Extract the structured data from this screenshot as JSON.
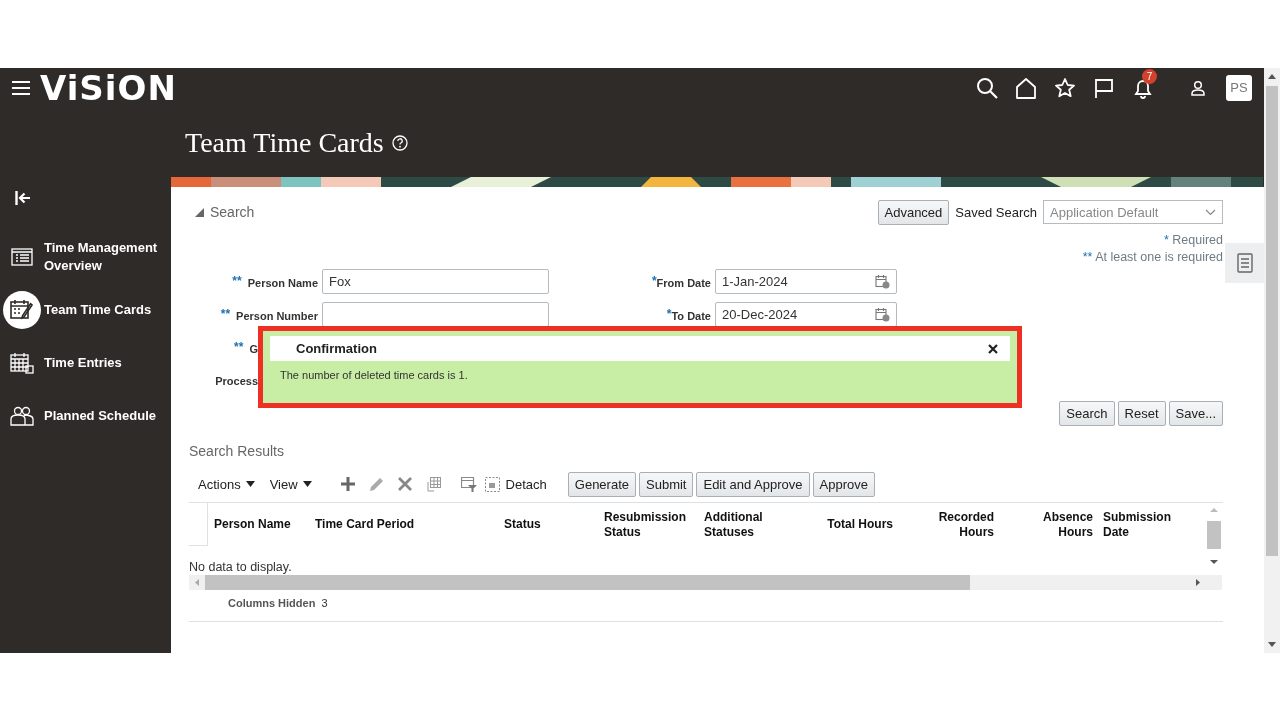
{
  "header": {
    "logo": "ViSiON",
    "notifications": "7",
    "avatar": "PS"
  },
  "sidebar": {
    "items": [
      {
        "label": "Time Management Overview",
        "selected": false
      },
      {
        "label": "Team Time Cards",
        "selected": true
      },
      {
        "label": "Time Entries",
        "selected": false
      },
      {
        "label": "Planned Schedule",
        "selected": false
      }
    ]
  },
  "page": {
    "title": "Team Time Cards"
  },
  "search": {
    "label": "Search",
    "expanded": true,
    "advanced": "Advanced",
    "saved_search_label": "Saved Search",
    "saved_search": "Application Default",
    "notes": [
      {
        "mark": "*",
        "text": "Required"
      },
      {
        "mark": "**",
        "text": "At least one is required"
      }
    ],
    "rows": [
      [
        {
          "label": "Person Name",
          "mark": "**",
          "kind": "text",
          "value": "Fox"
        },
        {
          "label": "From Date",
          "mark": "*",
          "kind": "date",
          "value": "1-Jan-2024"
        }
      ],
      [
        {
          "label": "Person Number",
          "mark": "**",
          "kind": "text"
        },
        {
          "label": "To Date",
          "mark": "*",
          "kind": "date",
          "value": "20-Dec-2024"
        }
      ],
      [
        {
          "label": "G",
          "mark": "**",
          "kind": "covered"
        }
      ],
      [
        {
          "label": "Process",
          "kind": "covered"
        }
      ]
    ],
    "buttons": [
      "Search",
      "Reset",
      "Save..."
    ]
  },
  "results": {
    "title": "Search Results",
    "menus": [
      "Actions",
      "View"
    ],
    "detach": "Detach",
    "buttons": [
      "Generate",
      "Submit",
      "Edit and Approve",
      "Approve"
    ],
    "columns": [
      {
        "label": "Person Name",
        "kind": "text"
      },
      {
        "label": "Time Card Period",
        "kind": "text"
      },
      {
        "label": "Status",
        "kind": "text"
      },
      {
        "label": "Resubmission Status",
        "kind": "text"
      },
      {
        "label": "Additional Statuses",
        "kind": "text"
      },
      {
        "label": "Total Hours",
        "kind": "number"
      },
      {
        "label": "Recorded Hours",
        "kind": "number"
      },
      {
        "label": "Absence Hours",
        "kind": "number"
      },
      {
        "label": "Submission Date",
        "kind": "text"
      }
    ],
    "empty_text": "No data to display.",
    "hidden_label": "Columns Hidden",
    "hidden_count": "3"
  },
  "confirmation": {
    "title": "Confirmation",
    "message": "The number of deleted time cards is 1."
  }
}
